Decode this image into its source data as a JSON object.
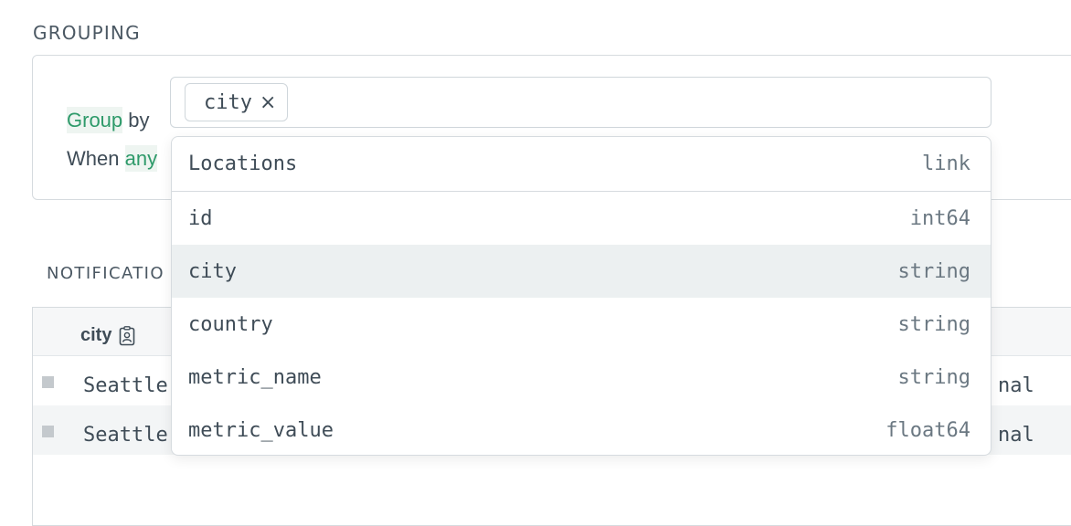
{
  "grouping": {
    "title": "GROUPING",
    "group_kw": "Group",
    "by_text": "by",
    "when_text": "When",
    "any_kw": "any",
    "selected_chip": "city",
    "remove_icon": "×"
  },
  "dropdown": {
    "header": {
      "label": "Locations",
      "type": "link"
    },
    "items": [
      {
        "label": "id",
        "type": "int64"
      },
      {
        "label": "city",
        "type": "string"
      },
      {
        "label": "country",
        "type": "string"
      },
      {
        "label": "metric_name",
        "type": "string"
      },
      {
        "label": "metric_value",
        "type": "float64"
      }
    ],
    "highlighted_index": 1
  },
  "notifications": {
    "title": "NOTIFICATIO",
    "column_city": "city",
    "rows": [
      {
        "city": "Seattle",
        "right": "nal"
      },
      {
        "city": "Seattle",
        "right": "nal"
      }
    ]
  },
  "colors": {
    "keyword_green": "#2e9a6a",
    "highlight_row": "#ecf0f1"
  }
}
